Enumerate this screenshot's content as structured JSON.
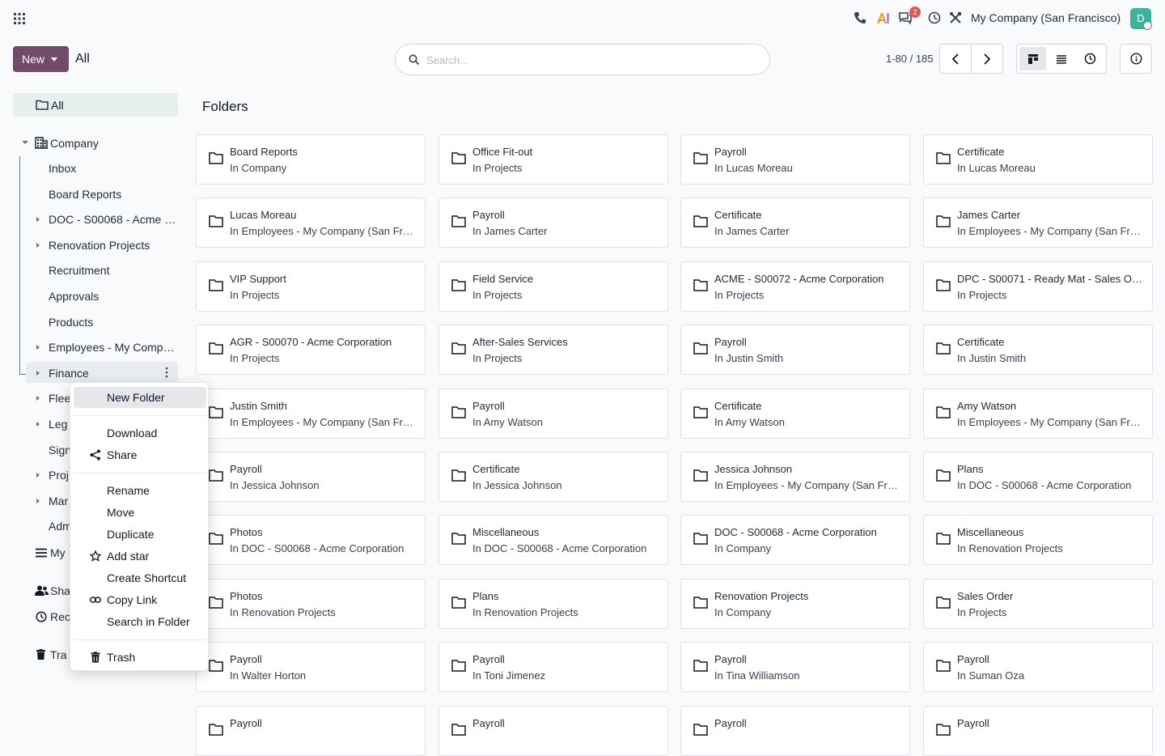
{
  "topbar": {
    "company": "My Company (San Francisco)",
    "notification_count": "2",
    "avatar_initial": "D"
  },
  "control": {
    "new_label": "New",
    "breadcrumb": "All",
    "search_placeholder": "Search...",
    "pager": "1-80 / 185"
  },
  "sidebar": {
    "all": "All",
    "company": "Company",
    "items": [
      {
        "label": "Inbox",
        "expand": false
      },
      {
        "label": "Board Reports",
        "expand": false
      },
      {
        "label": "DOC - S00068 - Acme …",
        "expand": true
      },
      {
        "label": "Renovation Projects",
        "expand": true
      },
      {
        "label": "Recruitment",
        "expand": false
      },
      {
        "label": "Approvals",
        "expand": false
      },
      {
        "label": "Products",
        "expand": false
      },
      {
        "label": "Employees - My Comp…",
        "expand": true
      },
      {
        "label": "Finance",
        "expand": true
      },
      {
        "label": "Flee",
        "expand": true
      },
      {
        "label": "Leg",
        "expand": true
      },
      {
        "label": "Sign",
        "expand": false
      },
      {
        "label": "Proj",
        "expand": true
      },
      {
        "label": "Mar",
        "expand": true
      },
      {
        "label": "Adm",
        "expand": false
      }
    ],
    "my": "My",
    "shared": "Sha",
    "recent": "Rec",
    "trash": "Tra"
  },
  "content": {
    "title": "Folders",
    "folders": [
      {
        "name": "Board Reports",
        "parent": "In Company"
      },
      {
        "name": "Office Fit-out",
        "parent": "In Projects"
      },
      {
        "name": "Payroll",
        "parent": "In Lucas Moreau"
      },
      {
        "name": "Certificate",
        "parent": "In Lucas Moreau"
      },
      {
        "name": "Lucas Moreau",
        "parent": "In Employees - My Company (San Francisco)"
      },
      {
        "name": "Payroll",
        "parent": "In James Carter"
      },
      {
        "name": "Certificate",
        "parent": "In James Carter"
      },
      {
        "name": "James Carter",
        "parent": "In Employees - My Company (San Francisco)"
      },
      {
        "name": "VIP Support",
        "parent": "In Projects"
      },
      {
        "name": "Field Service",
        "parent": "In Projects"
      },
      {
        "name": "ACME - S00072 - Acme Corporation",
        "parent": "In Projects"
      },
      {
        "name": "DPC - S00071 - Ready Mat - Sales Order",
        "parent": "In Projects"
      },
      {
        "name": "AGR - S00070 - Acme Corporation",
        "parent": "In Projects"
      },
      {
        "name": "After-Sales Services",
        "parent": "In Projects"
      },
      {
        "name": "Payroll",
        "parent": "In Justin Smith"
      },
      {
        "name": "Certificate",
        "parent": "In Justin Smith"
      },
      {
        "name": "Justin Smith",
        "parent": "In Employees - My Company (San Francisco)"
      },
      {
        "name": "Payroll",
        "parent": "In Amy Watson"
      },
      {
        "name": "Certificate",
        "parent": "In Amy Watson"
      },
      {
        "name": "Amy Watson",
        "parent": "In Employees - My Company (San Francisco)"
      },
      {
        "name": "Payroll",
        "parent": "In Jessica Johnson"
      },
      {
        "name": "Certificate",
        "parent": "In Jessica Johnson"
      },
      {
        "name": "Jessica Johnson",
        "parent": "In Employees - My Company (San Francisco)"
      },
      {
        "name": "Plans",
        "parent": "In DOC - S00068 - Acme Corporation"
      },
      {
        "name": "Photos",
        "parent": "In DOC - S00068 - Acme Corporation"
      },
      {
        "name": "Miscellaneous",
        "parent": "In DOC - S00068 - Acme Corporation"
      },
      {
        "name": "DOC - S00068 - Acme Corporation",
        "parent": "In Company"
      },
      {
        "name": "Miscellaneous",
        "parent": "In Renovation Projects"
      },
      {
        "name": "Photos",
        "parent": "In Renovation Projects"
      },
      {
        "name": "Plans",
        "parent": "In Renovation Projects"
      },
      {
        "name": "Renovation Projects",
        "parent": "In Company"
      },
      {
        "name": "Sales Order",
        "parent": "In Projects"
      },
      {
        "name": "Payroll",
        "parent": "In Walter Horton"
      },
      {
        "name": "Payroll",
        "parent": "In Toni Jimenez"
      },
      {
        "name": "Payroll",
        "parent": "In Tina Williamson"
      },
      {
        "name": "Payroll",
        "parent": "In Suman Oza"
      },
      {
        "name": "Payroll",
        "parent": ""
      },
      {
        "name": "Payroll",
        "parent": ""
      },
      {
        "name": "Payroll",
        "parent": ""
      },
      {
        "name": "Payroll",
        "parent": ""
      }
    ]
  },
  "menu": {
    "new_folder": "New Folder",
    "download": "Download",
    "share": "Share",
    "rename": "Rename",
    "move": "Move",
    "duplicate": "Duplicate",
    "add_star": "Add star",
    "create_shortcut": "Create Shortcut",
    "copy_link": "Copy Link",
    "search_in_folder": "Search in Folder",
    "trash": "Trash"
  }
}
